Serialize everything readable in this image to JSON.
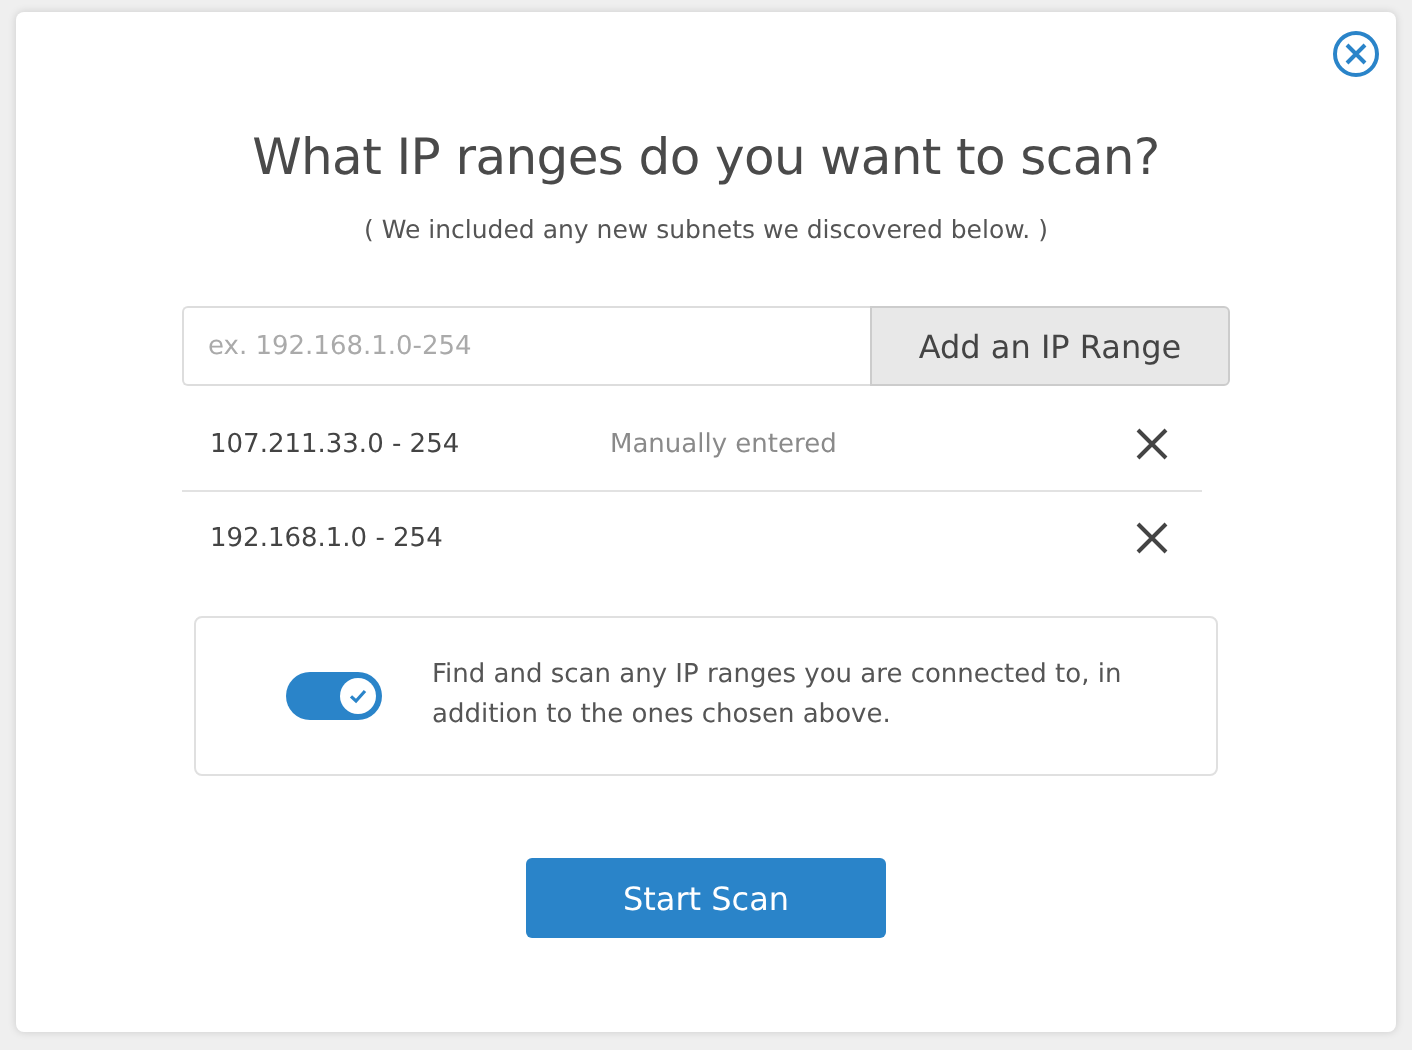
{
  "title": "What IP ranges do you want to scan?",
  "subtitle": "( We included any new subnets we discovered below. )",
  "ip_input": {
    "placeholder": "ex. 192.168.1.0-254"
  },
  "add_button": "Add an IP Range",
  "ranges": [
    {
      "range": "107.211.33.0 - 254",
      "source": "Manually entered"
    },
    {
      "range": "192.168.1.0 - 254"
    }
  ],
  "auto_scan": {
    "on": true,
    "text": "Find and scan any IP ranges you are connected to, in addition to the ones chosen above."
  },
  "start_button": "Start Scan"
}
